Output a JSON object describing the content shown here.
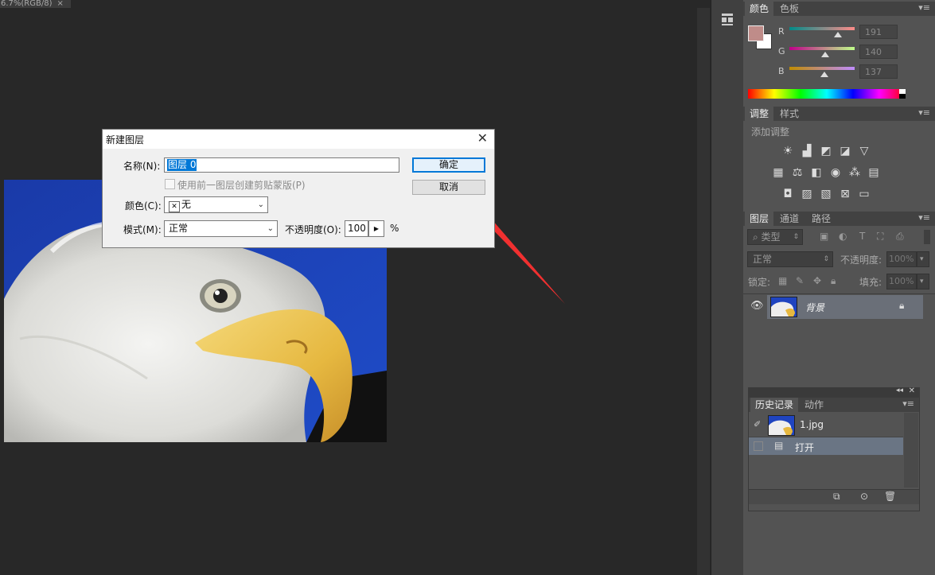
{
  "document": {
    "tab_title": "6.7%(RGB/8)",
    "tab_close": "×"
  },
  "dialog": {
    "title": "新建图层",
    "close": "✕",
    "name_label": "名称(N):",
    "name_value": "图层 0",
    "clip_checkbox_label": "使用前一图层创建剪贴蒙版(P)",
    "color_label": "颜色(C):",
    "color_value": "无",
    "color_x": "✕",
    "mode_label": "模式(M):",
    "mode_value": "正常",
    "opacity_label": "不透明度(O):",
    "opacity_value": "100",
    "opacity_unit": "%",
    "ok_label": "确定",
    "cancel_label": "取消"
  },
  "color_panel": {
    "tabs": [
      "颜色",
      "色板"
    ],
    "channels": [
      {
        "label": "R",
        "value": "191",
        "fraction": 0.749
      },
      {
        "label": "G",
        "value": "140",
        "fraction": 0.549
      },
      {
        "label": "B",
        "value": "137",
        "fraction": 0.537
      }
    ],
    "foreground": "#bf8c89",
    "background": "#ffffff"
  },
  "adjust_panel": {
    "tabs": [
      "调整",
      "样式"
    ],
    "add_label": "添加调整"
  },
  "layers_panel": {
    "tabs": [
      "图层",
      "通道",
      "路径"
    ],
    "filter_label": "类型",
    "blend_mode": "正常",
    "opacity_label": "不透明度:",
    "opacity_value": "100%",
    "lock_label": "锁定:",
    "fill_label": "填充:",
    "fill_value": "100%",
    "layer_name": "背景"
  },
  "history_panel": {
    "tabs": [
      "历史记录",
      "动作"
    ],
    "snapshot_name": "1.jpg",
    "step_name": "打开"
  },
  "colors": {
    "accent": "#0078d7",
    "arrow": "#f03030",
    "sky": "#1a3db4"
  }
}
